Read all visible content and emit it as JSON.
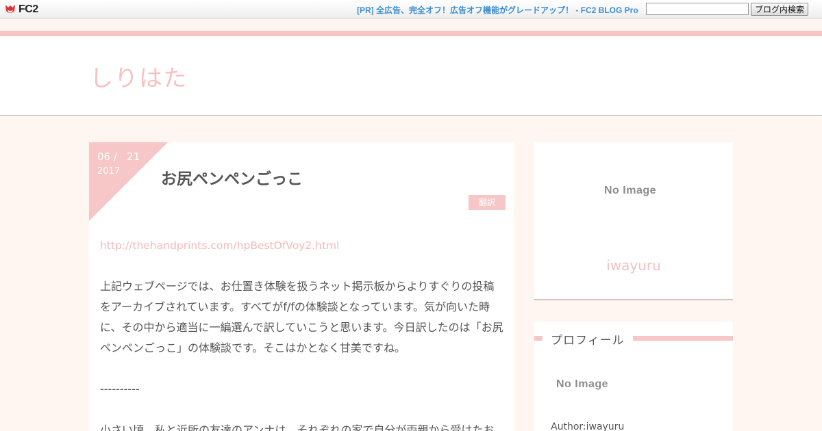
{
  "topbar": {
    "logo_text": "FC2",
    "pr_link": "[PR] 全広告、完全オフ！広告オフ機能がグレードアップ！ - FC2 BLOG Pro",
    "search_placeholder": "",
    "search_button": "ブログ内検索"
  },
  "blog": {
    "title": "しりはた"
  },
  "post": {
    "date_day": "06 /   21",
    "date_year": "2017",
    "title": "お尻ペンペンごっこ",
    "category": "翻訳",
    "link": "http://thehandprints.com/hpBestOfVoy2.html",
    "paragraph1": "上記ウェブページでは、お仕置き体験を扱うネット掲示板からよりすぐりの投稿をアーカイブされています。すべてがf/fの体験談となっています。気が向いた時に、その中から適当に一編選んで訳していこうと思います。今日訳したのは「お尻ペンペンごっこ」の体験談です。そこはかとなく甘美ですね。",
    "separator": "----------",
    "paragraph2": "小さい頃、私と近所の友達のアンナは、それぞれの家で自分が両親から受けたお"
  },
  "sidebar": {
    "no_image": "No Image",
    "author_link": "iwayuru",
    "profile_title": "プロフィール",
    "profile_no_image": "No Image",
    "profile_author": "Author:iwayuru"
  },
  "colors": {
    "accent_pink": "#f7c6c6",
    "link_blue": "#3c8fd2",
    "background": "#fff6f2"
  }
}
